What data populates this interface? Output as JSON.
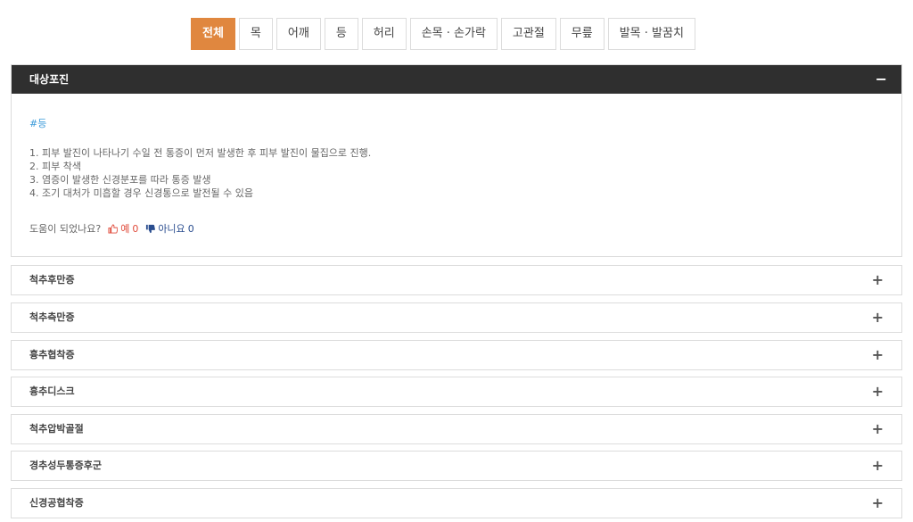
{
  "tabs": [
    {
      "label": "전체",
      "active": true
    },
    {
      "label": "목"
    },
    {
      "label": "어깨"
    },
    {
      "label": "등"
    },
    {
      "label": "허리"
    },
    {
      "label": "손목 · 손가락"
    },
    {
      "label": "고관절"
    },
    {
      "label": "무릎"
    },
    {
      "label": "발목 · 발꿈치"
    }
  ],
  "open_item": {
    "title": "대상포진",
    "toggle": "−",
    "tag": "#등",
    "lines": [
      "1. 피부 발진이 나타나기 수일 전 통증이 먼저 발생한 후 피부 발진이 물집으로 진행.",
      "2. 피부 착색",
      "3. 염증이 발생한 신경분포를 따라 통증 발생",
      "4. 조기 대처가 미흡할 경우 신경통으로 발전될 수 있음"
    ],
    "feedback": {
      "question": "도움이 되었나요?",
      "yes_label": "예",
      "yes_count": "0",
      "no_label": "아니요",
      "no_count": "0"
    }
  },
  "collapsed_items": [
    {
      "title": "척추후만증",
      "toggle": "+"
    },
    {
      "title": "척추측만증",
      "toggle": "+"
    },
    {
      "title": "흉추협착증",
      "toggle": "+"
    },
    {
      "title": "흉추디스크",
      "toggle": "+"
    },
    {
      "title": "척추압박골절",
      "toggle": "+"
    },
    {
      "title": "경추성두통증후군",
      "toggle": "+"
    },
    {
      "title": "신경공협착증",
      "toggle": "+"
    }
  ],
  "colors": {
    "accent": "#e0873f",
    "header": "#2f2f2f",
    "tag": "#3a9ad9",
    "yes": "#e04b3b",
    "no": "#2a4d8f"
  }
}
